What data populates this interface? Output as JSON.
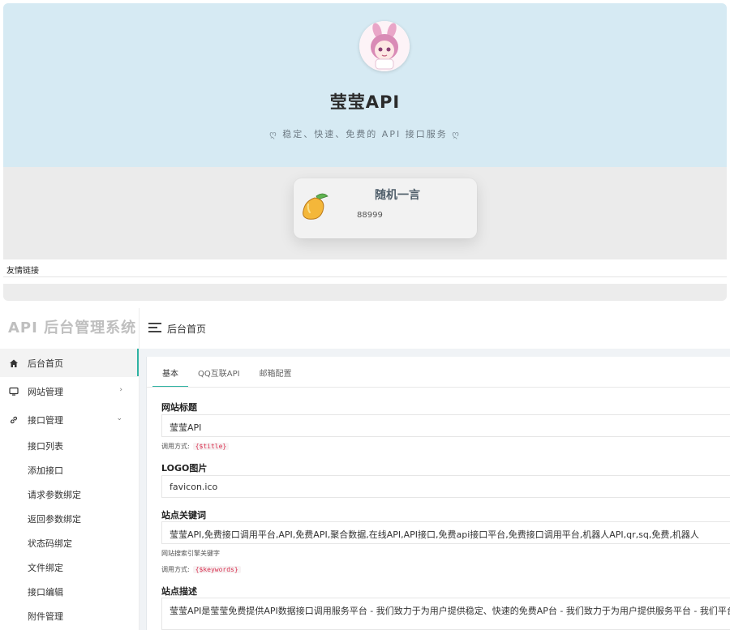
{
  "site": {
    "title": "莹莹API",
    "subtitle": "稳定、快速、免费的 API 接口服务",
    "subtitle_deco": "ღ",
    "card": {
      "title": "随机一言",
      "text": "88999"
    },
    "friend_links": "友情链接"
  },
  "admin": {
    "logo": "API 后台管理系统",
    "header_title": "后台首页",
    "nav": [
      {
        "label": "后台首页",
        "icon": "home-icon"
      },
      {
        "label": "网站管理",
        "icon": "monitor-icon",
        "arrow": "›"
      },
      {
        "label": "接口管理",
        "icon": "link-icon",
        "arrow": "⌄"
      }
    ],
    "sub_nav": [
      "接口列表",
      "添加接口",
      "请求参数绑定",
      "返回参数绑定",
      "状态码绑定",
      "文件绑定",
      "接口编辑",
      "附件管理"
    ],
    "tabs": [
      "基本",
      "QQ互联API",
      "邮箱配置"
    ],
    "form": {
      "title_label": "网站标题",
      "title_value": "莹莹API",
      "call_prefix": "调用方式:",
      "title_code": "{$title}",
      "logo_label": "LOGO图片",
      "logo_value": "favicon.ico",
      "keywords_label": "站点关键词",
      "keywords_value": "莹莹API,免费接口调用平台,API,免费API,聚合数据,在线API,API接口,免费api接口平台,免费接口调用平台,机器人API,qr,sq,免费,机器人",
      "keywords_hint": "网站搜索引擎关键字",
      "keywords_code": "{$keywords}",
      "desc_label": "站点描述",
      "desc_value": "莹莹API是莹莹免费提供API数据接口调用服务平台 - 我们致力于为用户提供稳定、快速的免费AP台 - 我们致力于为用户提供服务平台 - 我们平台"
    }
  },
  "colors": {
    "hero_bg": "#d6eaf3",
    "accent": "#2fb3a3",
    "code_red": "#d9304f"
  }
}
